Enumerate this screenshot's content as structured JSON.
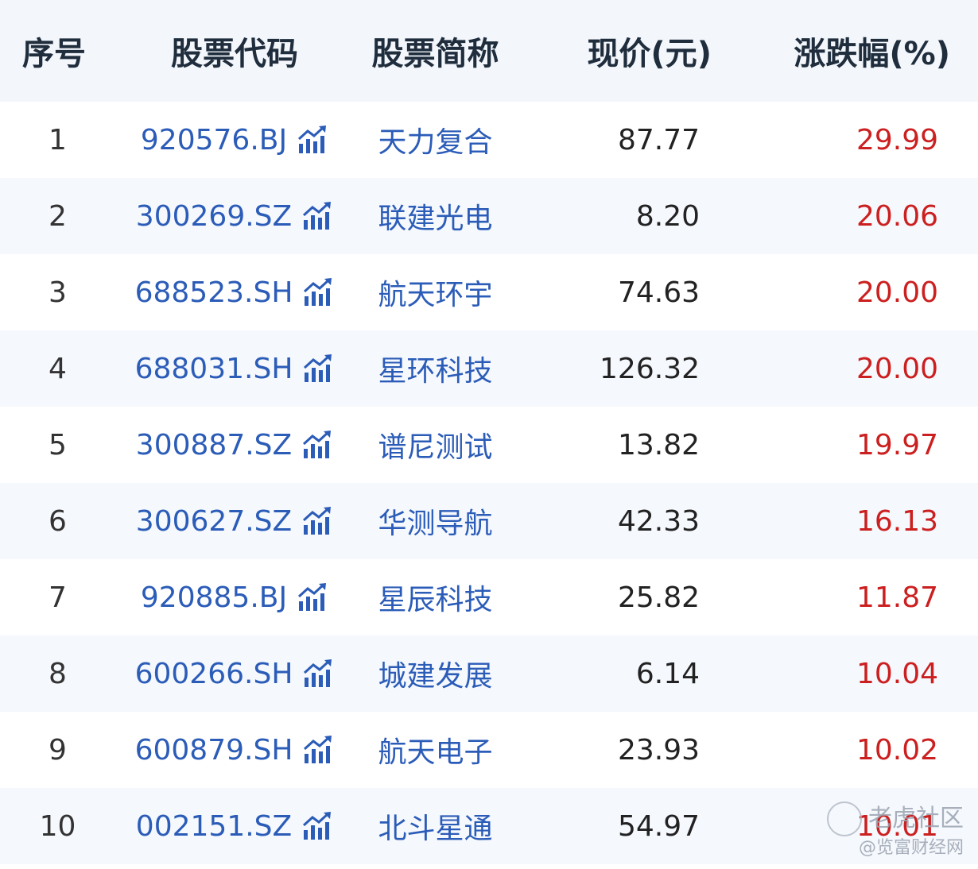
{
  "columns": {
    "idx": "序号",
    "code": "股票代码",
    "name": "股票简称",
    "price": "现价(元)",
    "change": "涨跌幅(%)"
  },
  "rows": [
    {
      "idx": "1",
      "code": "920576.BJ",
      "name": "天力复合",
      "price": "87.77",
      "change": "29.99"
    },
    {
      "idx": "2",
      "code": "300269.SZ",
      "name": "联建光电",
      "price": "8.20",
      "change": "20.06"
    },
    {
      "idx": "3",
      "code": "688523.SH",
      "name": "航天环宇",
      "price": "74.63",
      "change": "20.00"
    },
    {
      "idx": "4",
      "code": "688031.SH",
      "name": "星环科技",
      "price": "126.32",
      "change": "20.00"
    },
    {
      "idx": "5",
      "code": "300887.SZ",
      "name": "谱尼测试",
      "price": "13.82",
      "change": "19.97"
    },
    {
      "idx": "6",
      "code": "300627.SZ",
      "name": "华测导航",
      "price": "42.33",
      "change": "16.13"
    },
    {
      "idx": "7",
      "code": "920885.BJ",
      "name": "星辰科技",
      "price": "25.82",
      "change": "11.87"
    },
    {
      "idx": "8",
      "code": "600266.SH",
      "name": "城建发展",
      "price": "6.14",
      "change": "10.04"
    },
    {
      "idx": "9",
      "code": "600879.SH",
      "name": "航天电子",
      "price": "23.93",
      "change": "10.02"
    },
    {
      "idx": "10",
      "code": "002151.SZ",
      "name": "北斗星通",
      "price": "54.97",
      "change": "10.01"
    }
  ],
  "watermark": {
    "line1": "老虎社区",
    "line2": "@览富财经网"
  },
  "colors": {
    "link": "#2b5cb8",
    "up": "#cc1f1f",
    "stripe": "#f5f8fd"
  },
  "icons": {
    "trend": "trend-chart-icon"
  }
}
